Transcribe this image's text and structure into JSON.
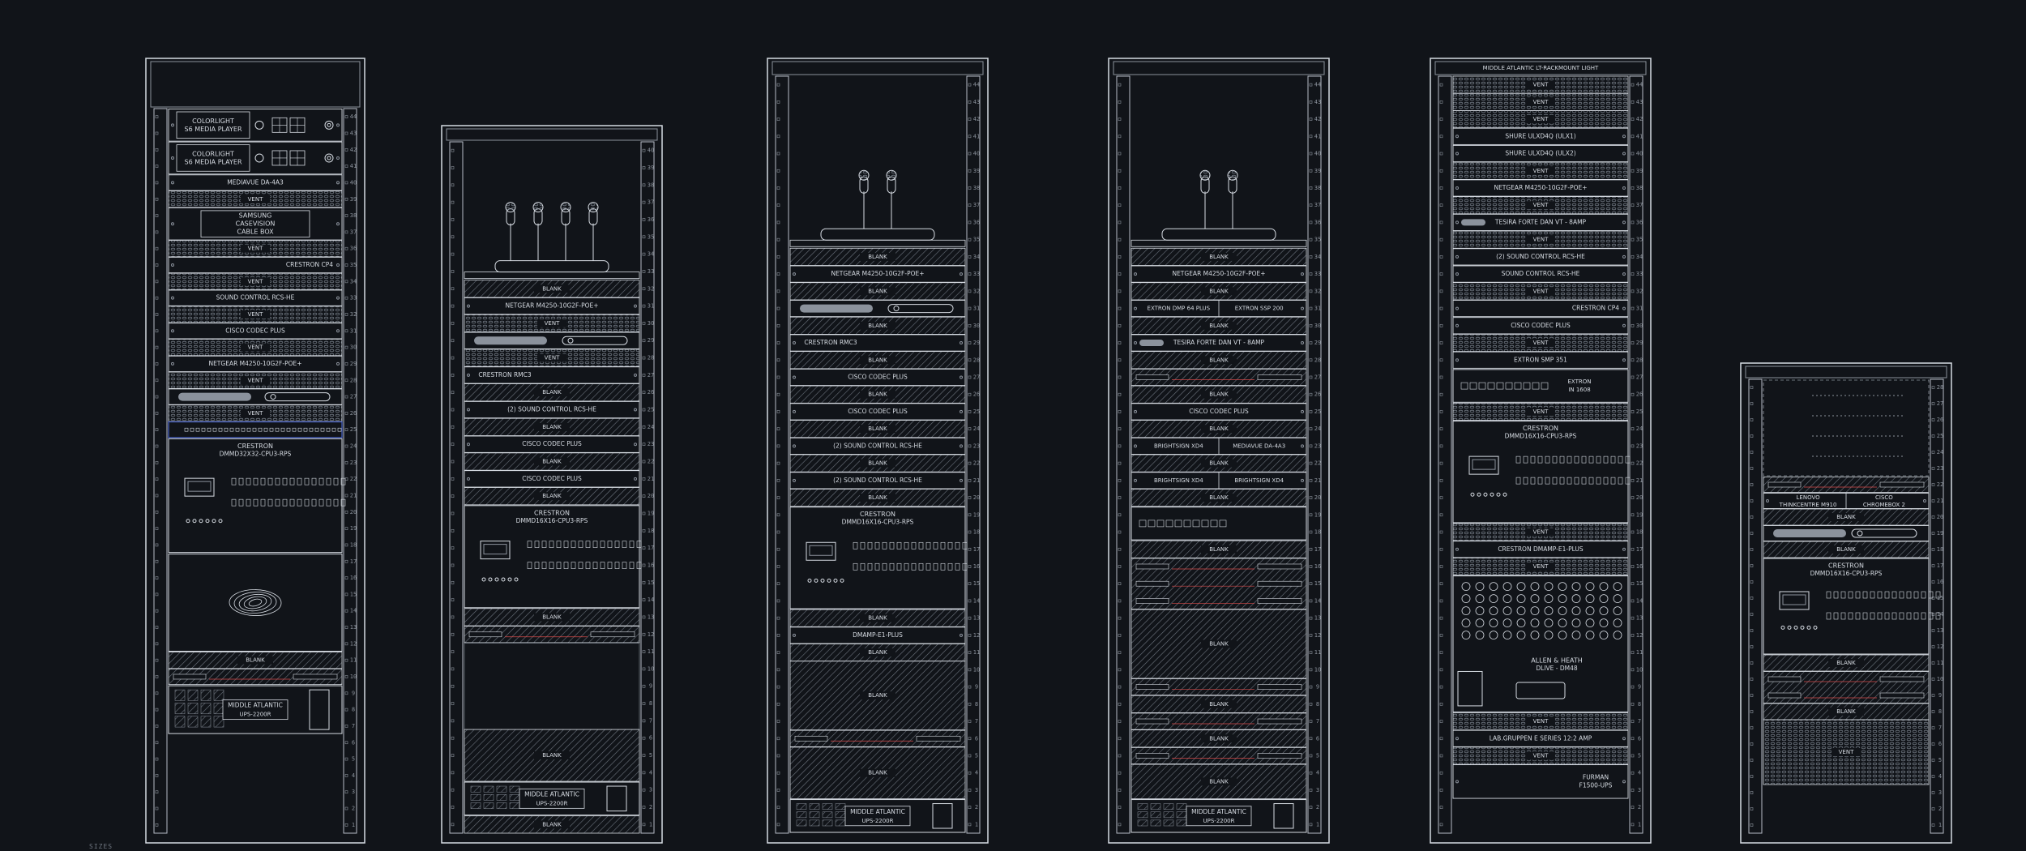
{
  "drawing": {
    "colors": {
      "background": "#111419",
      "line": "#d6dbe2",
      "dim": "#8b929c",
      "hatch": "#6d747e",
      "rail": "#b7bdc6",
      "accent_red": "#d84a4a",
      "accent_blue": "#4a63c9"
    },
    "racks": [
      {
        "id": "rack1",
        "units": 42,
        "devices": [
          {
            "type": "label",
            "u": 1,
            "h": 2,
            "lines": [
              "COLORLIGHT",
              "S6 MEDIA PLAYER"
            ],
            "icon": "media-player"
          },
          {
            "type": "label",
            "u": 3,
            "h": 2,
            "lines": [
              "COLORLIGHT",
              "S6 MEDIA PLAYER"
            ],
            "icon": "media-player"
          },
          {
            "type": "label",
            "u": 5,
            "h": 1,
            "lines": [
              "MEDIAVUE DA-4A3"
            ]
          },
          {
            "type": "vent",
            "u": 6,
            "h": 1,
            "label": "VENT"
          },
          {
            "type": "label",
            "u": 7,
            "h": 2,
            "lines": [
              "SAMSUNG",
              "CASEVISION",
              "CABLE BOX"
            ],
            "boxed": true
          },
          {
            "type": "vent",
            "u": 9,
            "h": 1,
            "label": "VENT"
          },
          {
            "type": "label",
            "u": 10,
            "h": 1,
            "lines": [
              "CRESTRON CP4"
            ],
            "align": "right"
          },
          {
            "type": "vent",
            "u": 11,
            "h": 1,
            "label": "VENT"
          },
          {
            "type": "label",
            "u": 12,
            "h": 1,
            "lines": [
              "SOUND CONTROL RCS-HE"
            ]
          },
          {
            "type": "vent",
            "u": 13,
            "h": 1,
            "label": "VENT"
          },
          {
            "type": "label",
            "u": 14,
            "h": 1,
            "lines": [
              "CISCO CODEC PLUS"
            ]
          },
          {
            "type": "vent",
            "u": 15,
            "h": 1,
            "label": "VENT"
          },
          {
            "type": "label",
            "u": 16,
            "h": 1,
            "lines": [
              "NETGEAR M4250-10G2F-POE+"
            ]
          },
          {
            "type": "vent",
            "u": 17,
            "h": 1,
            "label": "VENT"
          },
          {
            "type": "pill",
            "u": 18,
            "h": 1
          },
          {
            "type": "vent",
            "u": 19,
            "h": 1,
            "label": "VENT"
          },
          {
            "type": "patch",
            "u": 20,
            "h": 1
          },
          {
            "type": "matrix",
            "u": 21,
            "h": 7,
            "lines": [
              "CRESTRON",
              "DMMD32X32-CPU3-RPS"
            ]
          },
          {
            "type": "logo",
            "u": 28,
            "h": 6
          },
          {
            "type": "blank",
            "u": 34,
            "h": 1,
            "label": "BLANK"
          },
          {
            "type": "small",
            "u": 35,
            "h": 1
          },
          {
            "type": "ups",
            "u": 36,
            "h": 3,
            "lines": [
              "MIDDLE ATLANTIC",
              "UPS-2200R"
            ]
          }
        ]
      },
      {
        "id": "rack2",
        "units": 38,
        "devices": [
          {
            "type": "mics",
            "u": 1,
            "h": 8,
            "count": 4
          },
          {
            "type": "blank",
            "u": 9,
            "h": 1,
            "label": "BLANK"
          },
          {
            "type": "label",
            "u": 10,
            "h": 1,
            "lines": [
              "NETGEAR M4250-10G2F-POE+"
            ]
          },
          {
            "type": "vent",
            "u": 11,
            "h": 1,
            "label": "VENT"
          },
          {
            "type": "pill",
            "u": 12,
            "h": 1
          },
          {
            "type": "vent",
            "u": 13,
            "h": 1,
            "label": "VENT"
          },
          {
            "type": "label",
            "u": 14,
            "h": 1,
            "lines": [
              "CRESTRON RMC3"
            ],
            "align": "left"
          },
          {
            "type": "blank",
            "u": 15,
            "h": 1,
            "label": "BLANK"
          },
          {
            "type": "label",
            "u": 16,
            "h": 1,
            "lines": [
              "(2) SOUND CONTROL RCS-HE"
            ]
          },
          {
            "type": "blank",
            "u": 17,
            "h": 1,
            "label": "BLANK"
          },
          {
            "type": "label",
            "u": 18,
            "h": 1,
            "lines": [
              "CISCO CODEC PLUS"
            ]
          },
          {
            "type": "blank",
            "u": 19,
            "h": 1,
            "label": "BLANK"
          },
          {
            "type": "label",
            "u": 20,
            "h": 1,
            "lines": [
              "CISCO CODEC PLUS"
            ]
          },
          {
            "type": "blank",
            "u": 21,
            "h": 1,
            "label": "BLANK"
          },
          {
            "type": "matrix",
            "u": 22,
            "h": 6,
            "lines": [
              "CRESTRON",
              "DMMD16X16-CPU3-RPS"
            ]
          },
          {
            "type": "blank",
            "u": 28,
            "h": 1,
            "label": "BLANK"
          },
          {
            "type": "small",
            "u": 29,
            "h": 1
          },
          {
            "type": "empty",
            "u": 30,
            "h": 5
          },
          {
            "type": "blank",
            "u": 35,
            "h": 3,
            "label": "BLANK"
          },
          {
            "type": "ups",
            "u": 38,
            "h": 2,
            "lines": [
              "MIDDLE ATLANTIC",
              "UPS-2200R"
            ]
          },
          {
            "type": "blank",
            "u": 40,
            "h": 1,
            "label": "BLANK"
          }
        ]
      },
      {
        "id": "rack3",
        "units": 42,
        "devices": [
          {
            "type": "mics",
            "u": 1,
            "h": 10,
            "count": 2
          },
          {
            "type": "blank",
            "u": 11,
            "h": 1,
            "label": "BLANK"
          },
          {
            "type": "label",
            "u": 12,
            "h": 1,
            "lines": [
              "NETGEAR M4250-10G2F-POE+"
            ]
          },
          {
            "type": "blank",
            "u": 13,
            "h": 1,
            "label": "BLANK"
          },
          {
            "type": "pill",
            "u": 14,
            "h": 1
          },
          {
            "type": "blank",
            "u": 15,
            "h": 1,
            "label": "BLANK"
          },
          {
            "type": "label",
            "u": 16,
            "h": 1,
            "lines": [
              "CRESTRON RMC3"
            ],
            "align": "left"
          },
          {
            "type": "blank",
            "u": 17,
            "h": 1,
            "label": "BLANK"
          },
          {
            "type": "label",
            "u": 18,
            "h": 1,
            "lines": [
              "CISCO CODEC PLUS"
            ]
          },
          {
            "type": "blank",
            "u": 19,
            "h": 1,
            "label": "BLANK"
          },
          {
            "type": "label",
            "u": 20,
            "h": 1,
            "lines": [
              "CISCO CODEC PLUS"
            ]
          },
          {
            "type": "blank",
            "u": 21,
            "h": 1,
            "label": "BLANK"
          },
          {
            "type": "label",
            "u": 22,
            "h": 1,
            "lines": [
              "(2) SOUND CONTROL RCS-HE"
            ]
          },
          {
            "type": "blank",
            "u": 23,
            "h": 1,
            "label": "BLANK"
          },
          {
            "type": "label",
            "u": 24,
            "h": 1,
            "lines": [
              "(2) SOUND CONTROL RCS-HE"
            ]
          },
          {
            "type": "blank",
            "u": 25,
            "h": 1,
            "label": "BLANK"
          },
          {
            "type": "matrix",
            "u": 26,
            "h": 6,
            "lines": [
              "CRESTRON",
              "DMMD16X16-CPU3-RPS"
            ]
          },
          {
            "type": "blank",
            "u": 32,
            "h": 1,
            "label": "BLANK"
          },
          {
            "type": "label",
            "u": 33,
            "h": 1,
            "lines": [
              "DMAMP-E1-PLUS"
            ]
          },
          {
            "type": "blank",
            "u": 34,
            "h": 1,
            "label": "BLANK"
          },
          {
            "type": "blank",
            "u": 35,
            "h": 4,
            "label": "BLANK"
          },
          {
            "type": "small",
            "u": 39,
            "h": 1
          },
          {
            "type": "blank",
            "u": 40,
            "h": 3,
            "label": "BLANK"
          },
          {
            "type": "ups",
            "u": 43,
            "h": 2,
            "lines": [
              "MIDDLE ATLANTIC",
              "UPS-2200R"
            ]
          }
        ]
      },
      {
        "id": "rack4",
        "units": 42,
        "devices": [
          {
            "type": "mics",
            "u": 1,
            "h": 10,
            "count": 2
          },
          {
            "type": "blank",
            "u": 11,
            "h": 1,
            "label": "BLANK"
          },
          {
            "type": "label",
            "u": 12,
            "h": 1,
            "lines": [
              "NETGEAR M4250-10G2F-POE+"
            ]
          },
          {
            "type": "blank",
            "u": 13,
            "h": 1,
            "label": "BLANK"
          },
          {
            "type": "label",
            "u": 14,
            "h": 1,
            "lines": [
              "EXTRON DMP 64 PLUS",
              "EXTRON SSP 200"
            ],
            "split": true
          },
          {
            "type": "blank",
            "u": 15,
            "h": 1,
            "label": "BLANK"
          },
          {
            "type": "label",
            "u": 16,
            "h": 1,
            "lines": [
              "TESIRA FORTE DAN VT - 8AMP"
            ],
            "pill": true
          },
          {
            "type": "blank",
            "u": 17,
            "h": 1,
            "label": "BLANK"
          },
          {
            "type": "small",
            "u": 18,
            "h": 1
          },
          {
            "type": "blank",
            "u": 19,
            "h": 1,
            "label": "BLANK"
          },
          {
            "type": "label",
            "u": 20,
            "h": 1,
            "lines": [
              "CISCO CODEC PLUS"
            ]
          },
          {
            "type": "blank",
            "u": 21,
            "h": 1,
            "label": "BLANK"
          },
          {
            "type": "label",
            "u": 22,
            "h": 1,
            "lines": [
              "BRIGHTSIGN XD4",
              "MEDIAVUE DA-4A3"
            ],
            "split": true
          },
          {
            "type": "blank",
            "u": 23,
            "h": 1,
            "label": "BLANK"
          },
          {
            "type": "label",
            "u": 24,
            "h": 1,
            "lines": [
              "BRIGHTSIGN XD4",
              "BRIGHTSIGN XD4"
            ],
            "split": true
          },
          {
            "type": "blank",
            "u": 25,
            "h": 1,
            "label": "BLANK"
          },
          {
            "type": "panel",
            "u": 26,
            "h": 2
          },
          {
            "type": "blank",
            "u": 28,
            "h": 1,
            "label": "BLANK"
          },
          {
            "type": "small",
            "u": 29,
            "h": 3
          },
          {
            "type": "blank",
            "u": 32,
            "h": 4,
            "label": "BLANK"
          },
          {
            "type": "small",
            "u": 36,
            "h": 1
          },
          {
            "type": "blank",
            "u": 37,
            "h": 1,
            "label": "BLANK"
          },
          {
            "type": "small",
            "u": 38,
            "h": 1
          },
          {
            "type": "blank",
            "u": 39,
            "h": 1,
            "label": "BLANK"
          },
          {
            "type": "small",
            "u": 40,
            "h": 1
          },
          {
            "type": "blank",
            "u": 41,
            "h": 2,
            "label": "BLANK"
          },
          {
            "type": "ups",
            "u": 43,
            "h": 2,
            "lines": [
              "MIDDLE ATLANTIC",
              "UPS-2200R"
            ]
          }
        ]
      },
      {
        "id": "rack5",
        "units": 42,
        "header": "MIDDLE ATLANTIC LT-RACKMOUNT LIGHT",
        "devices": [
          {
            "type": "vent",
            "u": 1,
            "h": 1,
            "label": "VENT"
          },
          {
            "type": "vent",
            "u": 2,
            "h": 1,
            "label": "VENT"
          },
          {
            "type": "vent",
            "u": 3,
            "h": 1,
            "label": "VENT"
          },
          {
            "type": "label",
            "u": 4,
            "h": 1,
            "lines": [
              "SHURE ULXD4Q (ULX1)"
            ]
          },
          {
            "type": "label",
            "u": 5,
            "h": 1,
            "lines": [
              "SHURE ULXD4Q (ULX2)"
            ]
          },
          {
            "type": "vent",
            "u": 6,
            "h": 1,
            "label": "VENT"
          },
          {
            "type": "label",
            "u": 7,
            "h": 1,
            "lines": [
              "NETGEAR M4250-10G2F-POE+"
            ]
          },
          {
            "type": "vent",
            "u": 8,
            "h": 1,
            "label": "VENT"
          },
          {
            "type": "label",
            "u": 9,
            "h": 1,
            "lines": [
              "TESIRA FORTE DAN VT - 8AMP"
            ],
            "pill": true
          },
          {
            "type": "vent",
            "u": 10,
            "h": 1,
            "label": "VENT"
          },
          {
            "type": "label",
            "u": 11,
            "h": 1,
            "lines": [
              "(2) SOUND CONTROL RCS-HE"
            ]
          },
          {
            "type": "label",
            "u": 12,
            "h": 1,
            "lines": [
              "SOUND CONTROL RCS-HE"
            ]
          },
          {
            "type": "vent",
            "u": 13,
            "h": 1,
            "label": "VENT"
          },
          {
            "type": "label",
            "u": 14,
            "h": 1,
            "lines": [
              "CRESTRON CP4"
            ],
            "align": "right"
          },
          {
            "type": "label",
            "u": 15,
            "h": 1,
            "lines": [
              "CISCO CODEC PLUS"
            ]
          },
          {
            "type": "vent",
            "u": 16,
            "h": 1,
            "label": "VENT"
          },
          {
            "type": "label",
            "u": 17,
            "h": 1,
            "lines": [
              "EXTRON SMP 351"
            ]
          },
          {
            "type": "panel",
            "u": 18,
            "h": 2,
            "lines": [
              "EXTRON",
              "IN 1608"
            ]
          },
          {
            "type": "vent",
            "u": 20,
            "h": 1,
            "label": "VENT"
          },
          {
            "type": "matrix",
            "u": 21,
            "h": 6,
            "lines": [
              "CRESTRON",
              "DMMD16X16-CPU3-RPS"
            ]
          },
          {
            "type": "vent",
            "u": 27,
            "h": 1,
            "label": "VENT"
          },
          {
            "type": "label",
            "u": 28,
            "h": 1,
            "lines": [
              "CRESTRON DMAMP-E1-PLUS"
            ]
          },
          {
            "type": "vent",
            "u": 29,
            "h": 1,
            "label": "VENT"
          },
          {
            "type": "knobs",
            "u": 30,
            "h": 8,
            "lines": [
              "ALLEN & HEATH",
              "DLIVE - DM48"
            ]
          },
          {
            "type": "vent",
            "u": 38,
            "h": 1,
            "label": "VENT"
          },
          {
            "type": "label",
            "u": 39,
            "h": 1,
            "lines": [
              "LAB.GRUPPEN E SERIES 12:2 AMP"
            ]
          },
          {
            "type": "vent",
            "u": 40,
            "h": 1,
            "label": "VENT"
          },
          {
            "type": "label",
            "u": 41,
            "h": 2,
            "lines": [
              "FURMAN",
              "F1500-UPS"
            ],
            "align": "right"
          }
        ]
      },
      {
        "id": "rack6",
        "units": 26,
        "devices": [
          {
            "type": "shelf",
            "u": 1,
            "h": 6
          },
          {
            "type": "small",
            "u": 7,
            "h": 1
          },
          {
            "type": "label",
            "u": 8,
            "h": 1,
            "lines": [
              "LENOVO",
              "THINKCENTRE M910",
              "CISCO",
              "CHROMEBOX 2"
            ],
            "split2": true
          },
          {
            "type": "blank",
            "u": 9,
            "h": 1,
            "label": "BLANK"
          },
          {
            "type": "pill",
            "u": 10,
            "h": 1
          },
          {
            "type": "blank",
            "u": 11,
            "h": 1,
            "label": "BLANK"
          },
          {
            "type": "matrix",
            "u": 12,
            "h": 6,
            "lines": [
              "CRESTRON",
              "DMMD16X16-CPU3-RPS"
            ]
          },
          {
            "type": "blank",
            "u": 18,
            "h": 1,
            "label": "BLANK"
          },
          {
            "type": "small",
            "u": 19,
            "h": 2
          },
          {
            "type": "blank",
            "u": 21,
            "h": 1,
            "label": "BLANK"
          },
          {
            "type": "vent",
            "u": 22,
            "h": 4,
            "label": "VENT"
          }
        ]
      }
    ],
    "corner_label": "SIZES"
  }
}
